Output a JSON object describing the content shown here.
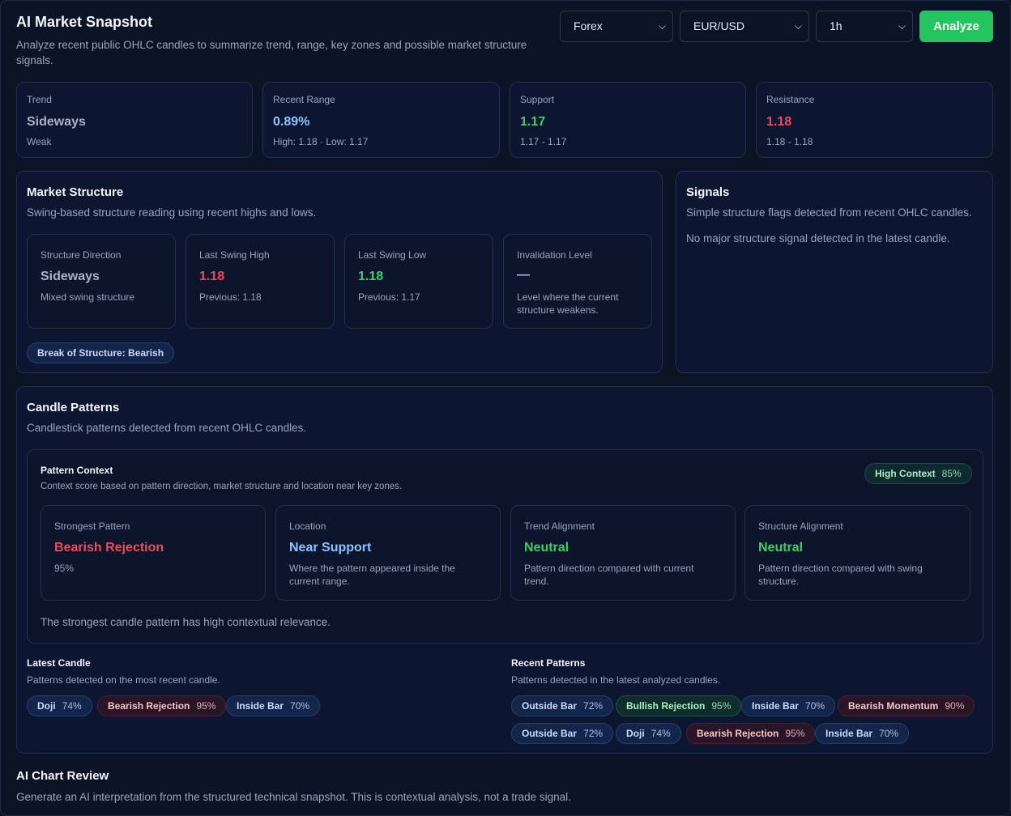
{
  "header": {
    "title": "AI Market Snapshot",
    "subtitle": "Analyze recent public OHLC candles to summarize trend, range, key zones and possible market structure signals.",
    "market_select": "Forex",
    "symbol_select": "EUR/USD",
    "timeframe_select": "1h",
    "analyze_label": "Analyze"
  },
  "stats": [
    {
      "label": "Trend",
      "value": "Sideways",
      "detail": "Weak"
    },
    {
      "label": "Recent Range",
      "value": "0.89%",
      "detail": "High: 1.18 · Low: 1.17"
    },
    {
      "label": "Support",
      "value": "1.17",
      "detail": "1.17 - 1.17"
    },
    {
      "label": "Resistance",
      "value": "1.18",
      "detail": "1.18 - 1.18"
    }
  ],
  "market_structure": {
    "title": "Market Structure",
    "subtitle": "Swing-based structure reading using recent highs and lows.",
    "cards": [
      {
        "label": "Structure Direction",
        "value": "Sideways",
        "detail": "Mixed swing structure"
      },
      {
        "label": "Last Swing High",
        "value": "1.18",
        "detail": "Previous: 1.18"
      },
      {
        "label": "Last Swing Low",
        "value": "1.18",
        "detail": "Previous: 1.17"
      },
      {
        "label": "Invalidation Level",
        "value": "—",
        "detail": "Level where the current structure weakens."
      }
    ],
    "badge": "Break of Structure: Bearish"
  },
  "signals": {
    "title": "Signals",
    "subtitle": "Simple structure flags detected from recent OHLC candles.",
    "empty_text": "No major structure signal detected in the latest candle."
  },
  "candle_patterns": {
    "title": "Candle Patterns",
    "subtitle": "Candlestick patterns detected from recent OHLC candles.",
    "context": {
      "title": "Pattern Context",
      "subtitle": "Context score based on pattern direction, market structure and location near key zones.",
      "badge_label": "High Context",
      "badge_pct": "85%",
      "cards": [
        {
          "label": "Strongest Pattern",
          "value": "Bearish Rejection",
          "detail": "95%"
        },
        {
          "label": "Location",
          "value": "Near Support",
          "detail": "Where the pattern appeared inside the current range."
        },
        {
          "label": "Trend Alignment",
          "value": "Neutral",
          "detail": "Pattern direction compared with current trend."
        },
        {
          "label": "Structure Alignment",
          "value": "Neutral",
          "detail": "Pattern direction compared with swing structure."
        }
      ],
      "summary": "The strongest candle pattern has high contextual relevance."
    },
    "latest": {
      "title": "Latest Candle",
      "subtitle": "Patterns detected on the most recent candle.",
      "pills": [
        {
          "name": "Doji",
          "pct": "74%"
        },
        {
          "name": "Bearish Rejection",
          "pct": "95%"
        },
        {
          "name": "Inside Bar",
          "pct": "70%"
        }
      ]
    },
    "recent": {
      "title": "Recent Patterns",
      "subtitle": "Patterns detected in the latest analyzed candles.",
      "pills": [
        {
          "name": "Outside Bar",
          "pct": "72%"
        },
        {
          "name": "Bullish Rejection",
          "pct": "95%"
        },
        {
          "name": "Inside Bar",
          "pct": "70%"
        },
        {
          "name": "Bearish Momentum",
          "pct": "90%"
        },
        {
          "name": "Outside Bar",
          "pct": "72%"
        },
        {
          "name": "Doji",
          "pct": "74%"
        },
        {
          "name": "Bearish Rejection",
          "pct": "95%"
        },
        {
          "name": "Inside Bar",
          "pct": "70%"
        }
      ]
    }
  },
  "ai_review": {
    "title": "AI Chart Review",
    "subtitle": "Generate an AI interpretation from the structured technical snapshot. This is contextual analysis, not a trade signal."
  }
}
